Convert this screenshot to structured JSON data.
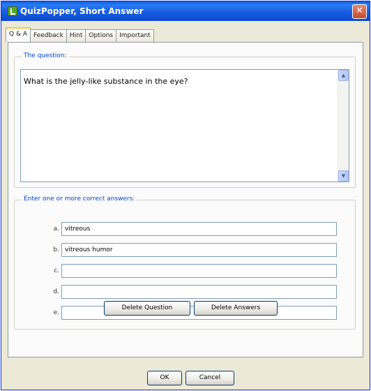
{
  "window": {
    "title": "QuizPopper, Short Answer",
    "close_glyph": "✕"
  },
  "tabs": [
    {
      "label": "Q & A",
      "active": true
    },
    {
      "label": "Feedback",
      "active": false
    },
    {
      "label": "Hint",
      "active": false
    },
    {
      "label": "Options",
      "active": false
    },
    {
      "label": "Important",
      "active": false
    }
  ],
  "question": {
    "legend": "The question:",
    "text": "What is the jelly-like substance in the eye?"
  },
  "answers": {
    "legend": "Enter one or more correct answers:",
    "items": [
      {
        "letter": "a.",
        "value": "vitreous"
      },
      {
        "letter": "b.",
        "value": "vitreous humor"
      },
      {
        "letter": "c.",
        "value": ""
      },
      {
        "letter": "d.",
        "value": ""
      },
      {
        "letter": "e.",
        "value": ""
      }
    ]
  },
  "buttons": {
    "delete_question": "Delete Question",
    "delete_answers": "Delete Answers",
    "ok": "OK",
    "cancel": "Cancel"
  },
  "icons": {
    "app": "quizpopper-app-icon",
    "close": "close-icon",
    "scroll_up": "scroll-up-arrow-icon",
    "scroll_down": "scroll-down-arrow-icon"
  },
  "colors": {
    "titlebar": "#0b48d0",
    "legend_text": "#0046d5",
    "active_tab_accent": "#ffc83c"
  }
}
